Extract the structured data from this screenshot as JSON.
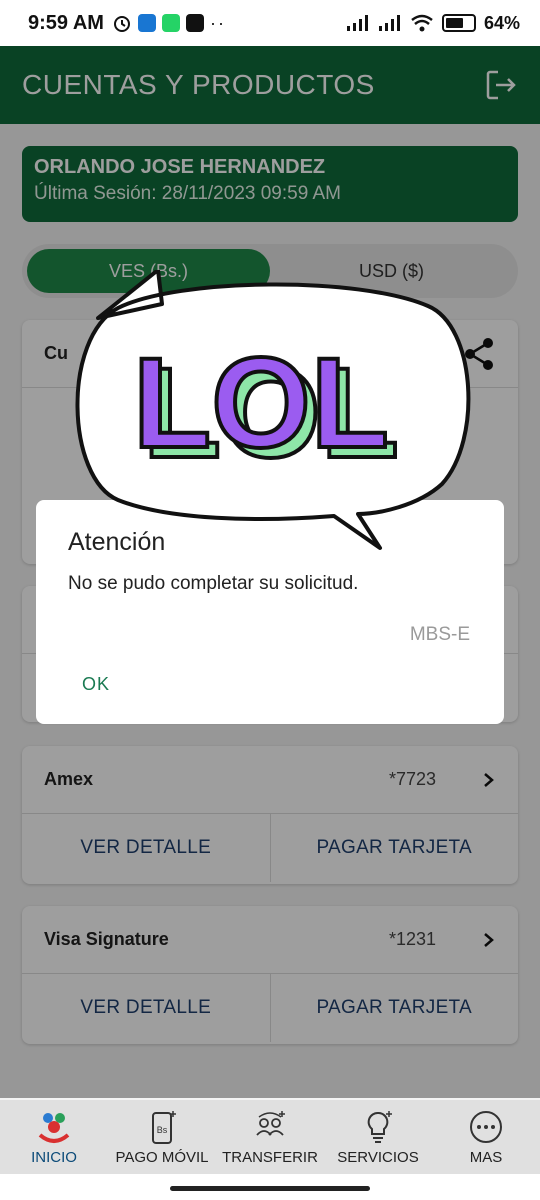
{
  "status_bar": {
    "time": "9:59 AM",
    "battery": "64%",
    "battery_level": 0.64,
    "left_icons": [
      "alarm-icon",
      "chat-app-icon",
      "whatsapp-icon",
      "binance-icon",
      "more-dots-icon"
    ],
    "right_icons": [
      "signal-icon",
      "signal-icon",
      "wifi-icon",
      "battery-icon"
    ]
  },
  "header": {
    "title": "CUENTAS Y PRODUCTOS",
    "logout_icon": "logout-icon"
  },
  "user": {
    "name": "ORLANDO JOSE HERNANDEZ",
    "last_session": "Última Sesión: 28/11/2023 09:59 AM"
  },
  "currency": {
    "options": [
      "VES (Bs.)",
      "USD ($)"
    ],
    "selected": "VES (Bs.)"
  },
  "partial_card": {
    "label": "Cu",
    "share_icon": "share-icon"
  },
  "cards": [
    {
      "name": "Amex",
      "number": "*7723",
      "action_1": "VER DETALLE",
      "action_2": "PAGAR TARJETA"
    },
    {
      "name": "Visa Signature",
      "number": "*1231",
      "action_1": "VER DETALLE",
      "action_2": "PAGAR TARJETA"
    }
  ],
  "sticker": {
    "text": "LOL",
    "fill_color": "#9b5cf0",
    "side_color": "#8ee6a8"
  },
  "dialog": {
    "title": "Atención",
    "message": "No se pudo completar su solicitud.",
    "code": "MBS-E",
    "ok_label": "OK"
  },
  "bottom_nav": [
    {
      "label": "INICIO",
      "icon": "home-logo-icon",
      "active": true
    },
    {
      "label": "PAGO MÓVIL",
      "icon": "mobile-payment-icon",
      "active": false
    },
    {
      "label": "TRANSFERIR",
      "icon": "transfer-icon",
      "active": false
    },
    {
      "label": "SERVICIOS",
      "icon": "lightbulb-icon",
      "active": false
    },
    {
      "label": "MAS",
      "icon": "more-icon",
      "active": false
    }
  ],
  "colors": {
    "brand_green": "#0f6b3a",
    "toggle_active": "#1f8a4a",
    "link_blue": "#1f3f6e",
    "ok_green": "#1a7a52"
  }
}
